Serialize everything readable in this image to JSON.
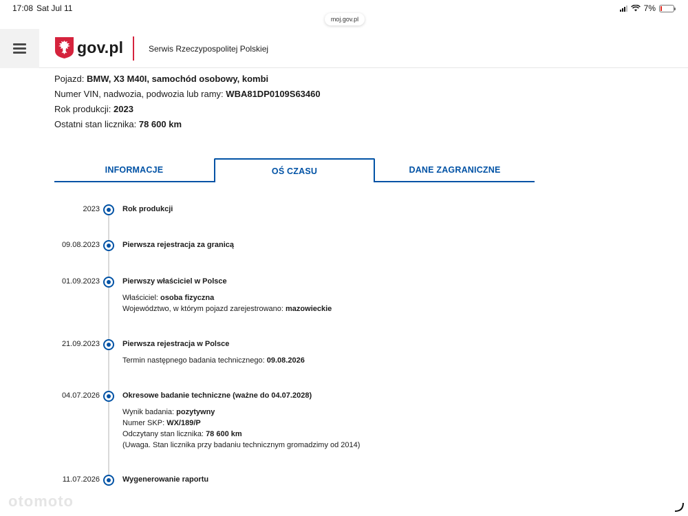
{
  "status_bar": {
    "time": "17:08",
    "date": "Sat Jul 11",
    "battery": "7%"
  },
  "browser": {
    "url": "moj.gov.pl"
  },
  "header": {
    "logo_text": "gov.pl",
    "service_name": "Serwis Rzeczypospolitej Polskiej"
  },
  "vehicle": {
    "pojazd_label": "Pojazd:",
    "pojazd_value": "BMW, X3 M40I, samochód osobowy, kombi",
    "vin_label": "Numer VIN, nadwozia, podwozia lub ramy:",
    "vin_value": "WBA81DP0109S63460",
    "rok_label": "Rok produkcji:",
    "rok_value": "2023",
    "licznik_label": "Ostatni stan licznika:",
    "licznik_value": "78 600 km"
  },
  "tabs": [
    {
      "label": "INFORMACJE"
    },
    {
      "label": "OŚ CZASU",
      "active": true
    },
    {
      "label": "DANE ZAGRANICZNE"
    }
  ],
  "timeline": [
    {
      "date": "2023",
      "title": "Rok produkcji"
    },
    {
      "date": "09.08.2023",
      "title": "Pierwsza rejestracja za granicą"
    },
    {
      "date": "01.09.2023",
      "title": "Pierwszy właściciel w Polsce",
      "d1_label": "Właściciel:",
      "d1_value": "osoba fizyczna",
      "d2_label": "Województwo, w którym pojazd zarejestrowano:",
      "d2_value": "mazowieckie"
    },
    {
      "date": "21.09.2023",
      "title": "Pierwsza rejestracja w Polsce",
      "d1_label": "Termin następnego badania technicznego:",
      "d1_value": "09.08.2026"
    },
    {
      "date": "04.07.2026",
      "title": "Okresowe badanie techniczne (ważne do 04.07.2028)",
      "d1_label": "Wynik badania:",
      "d1_value": "pozytywny",
      "d2_label": "Numer SKP:",
      "d2_value": "WX/189/P",
      "d3_label": "Odczytany stan licznika:",
      "d3_value": "78 600 km",
      "d4_text": "(Uwaga. Stan licznika przy badaniu technicznym gromadzimy od 2014)"
    },
    {
      "date": "11.07.2026",
      "title": "Wygenerowanie raportu"
    }
  ],
  "watermark": "otomoto",
  "colors": {
    "accent": "#0052a5",
    "logo_red": "#d5233d",
    "timeline_line": "#d9d9d9"
  }
}
